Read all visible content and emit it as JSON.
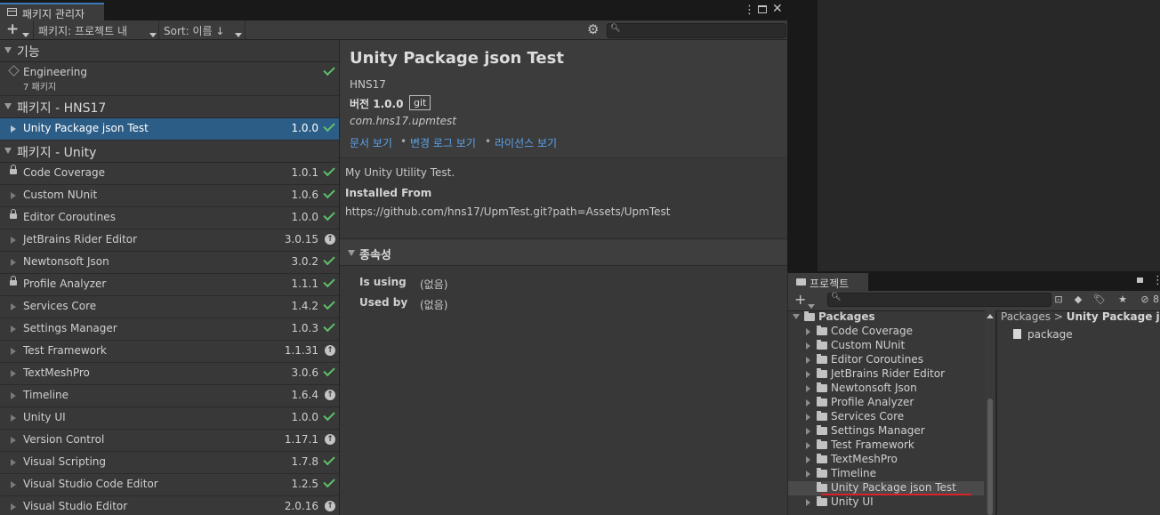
{
  "package_manager": {
    "tab_title": "패키지 관리자",
    "toolbar": {
      "add_label": "+",
      "packages_dropdown": "패키지: 프로젝트 내",
      "sort_dropdown": "Sort: 이름 ↓",
      "search_placeholder": ""
    },
    "groups": {
      "features": "기능",
      "hns17": "패키지 - HNS17",
      "unity": "패키지 - Unity"
    },
    "feature_item": {
      "name": "Engineering",
      "subtitle": "7 패키지"
    },
    "hns17_packages": [
      {
        "name": "Unity Package json Test",
        "version": "1.0.0",
        "status": "installed"
      }
    ],
    "unity_packages": [
      {
        "name": "Code Coverage",
        "version": "1.0.1",
        "locked": true,
        "status": "installed"
      },
      {
        "name": "Custom NUnit",
        "version": "1.0.6",
        "locked": false,
        "status": "installed"
      },
      {
        "name": "Editor Coroutines",
        "version": "1.0.0",
        "locked": true,
        "status": "installed"
      },
      {
        "name": "JetBrains Rider Editor",
        "version": "3.0.15",
        "locked": false,
        "status": "update"
      },
      {
        "name": "Newtonsoft Json",
        "version": "3.0.2",
        "locked": false,
        "status": "installed"
      },
      {
        "name": "Profile Analyzer",
        "version": "1.1.1",
        "locked": true,
        "status": "installed"
      },
      {
        "name": "Services Core",
        "version": "1.4.2",
        "locked": false,
        "status": "installed"
      },
      {
        "name": "Settings Manager",
        "version": "1.0.3",
        "locked": false,
        "status": "installed"
      },
      {
        "name": "Test Framework",
        "version": "1.1.31",
        "locked": false,
        "status": "update"
      },
      {
        "name": "TextMeshPro",
        "version": "3.0.6",
        "locked": false,
        "status": "installed"
      },
      {
        "name": "Timeline",
        "version": "1.6.4",
        "locked": false,
        "status": "update"
      },
      {
        "name": "Unity UI",
        "version": "1.0.0",
        "locked": false,
        "status": "installed"
      },
      {
        "name": "Version Control",
        "version": "1.17.1",
        "locked": false,
        "status": "update"
      },
      {
        "name": "Visual Scripting",
        "version": "1.7.8",
        "locked": false,
        "status": "installed"
      },
      {
        "name": "Visual Studio Code Editor",
        "version": "1.2.5",
        "locked": false,
        "status": "installed"
      },
      {
        "name": "Visual Studio Editor",
        "version": "2.0.16",
        "locked": false,
        "status": "update"
      }
    ],
    "details": {
      "title": "Unity Package json Test",
      "author": "HNS17",
      "version_label": "버전 1.0.0",
      "source_badge": "git",
      "package_id": "com.hns17.upmtest",
      "links": [
        "문서 보기",
        "변경 로그 보기",
        "라이선스 보기"
      ],
      "link_separator": "•",
      "description": "My Unity Utility Test.",
      "installed_from_label": "Installed From",
      "installed_from_url": "https://github.com/hns17/UpmTest.git?path=Assets/UpmTest",
      "dependencies_header": "종속성",
      "is_using_label": "Is using",
      "is_using_value": "(없음)",
      "used_by_label": "Used by",
      "used_by_value": "(없음)"
    }
  },
  "project_window": {
    "tab_title": "프로젝트",
    "add_label": "+",
    "hidden_count": "8",
    "tree_root": "Packages",
    "tree_items": [
      "Code Coverage",
      "Custom NUnit",
      "Editor Coroutines",
      "JetBrains Rider Editor",
      "Newtonsoft Json",
      "Profile Analyzer",
      "Services Core",
      "Settings Manager",
      "Test Framework",
      "TextMeshPro",
      "Timeline",
      "Unity Package json Test",
      "Unity UI"
    ],
    "highlighted_item": "Unity Package json Test",
    "breadcrumb": {
      "root": "Packages",
      "separator": ">",
      "current": "Unity Package json Test"
    },
    "assets": [
      "package"
    ]
  },
  "colors": {
    "selection": "#2c5d87",
    "check": "#5fbf6a",
    "link": "#5aa3ed",
    "annotation_underline": "#d9232b"
  }
}
